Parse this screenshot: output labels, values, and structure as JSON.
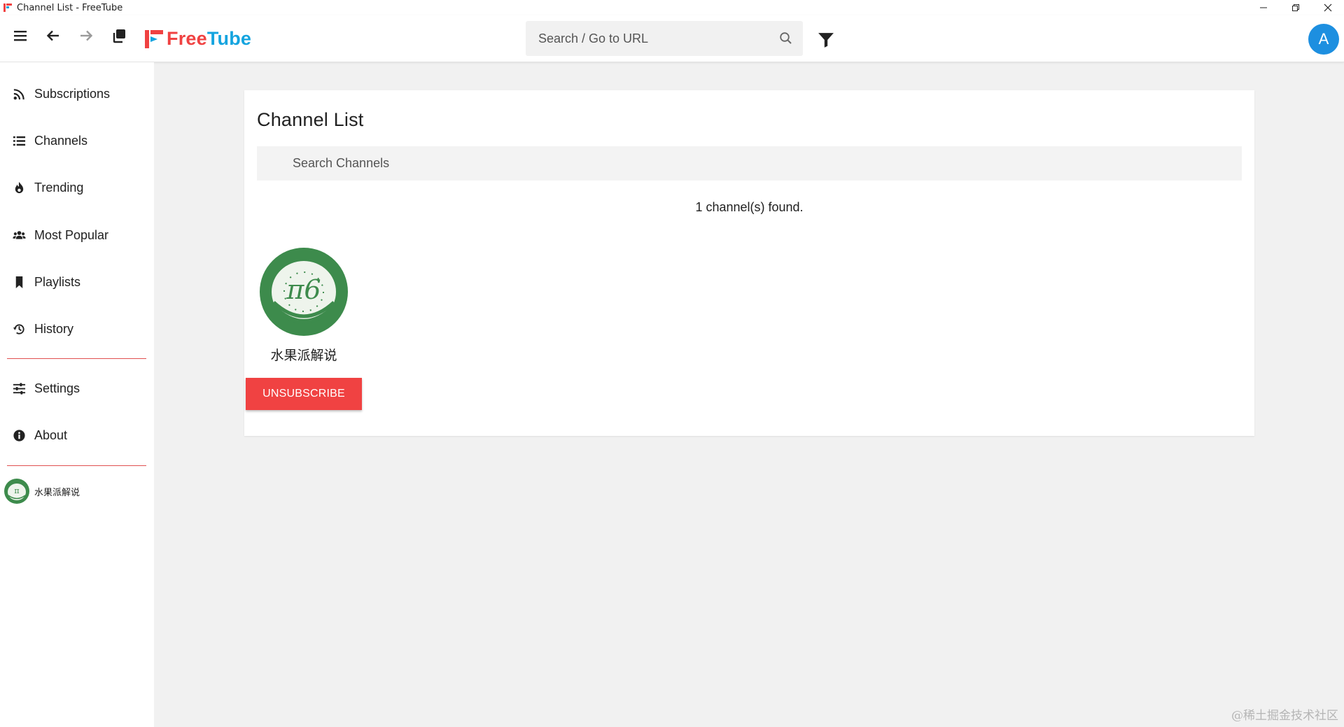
{
  "window": {
    "title": "Channel List - FreeTube"
  },
  "topnav": {
    "logo_free": "Free",
    "logo_tube": "Tube",
    "search_placeholder": "Search / Go to URL",
    "profile_initial": "A",
    "brand_red": "#f04242",
    "brand_blue": "#14a4df",
    "profile_color": "#1d8fe0"
  },
  "sidebar": {
    "items": [
      {
        "label": "Subscriptions",
        "icon": "rss-icon"
      },
      {
        "label": "Channels",
        "icon": "list-icon"
      },
      {
        "label": "Trending",
        "icon": "fire-icon"
      },
      {
        "label": "Most Popular",
        "icon": "users-icon"
      },
      {
        "label": "Playlists",
        "icon": "bookmark-icon"
      },
      {
        "label": "History",
        "icon": "history-icon"
      },
      {
        "label": "Settings",
        "icon": "sliders-icon"
      },
      {
        "label": "About",
        "icon": "info-icon"
      }
    ],
    "subscribed_channel": "水果派解说",
    "divider_color": "#e05050"
  },
  "main": {
    "heading": "Channel List",
    "search_placeholder": "Search Channels",
    "count_text": "1 channel(s) found.",
    "channels": [
      {
        "name": "水果派解说",
        "button_label": "UNSUBSCRIBE"
      }
    ]
  },
  "watermark": "@稀土掘金技术社区"
}
